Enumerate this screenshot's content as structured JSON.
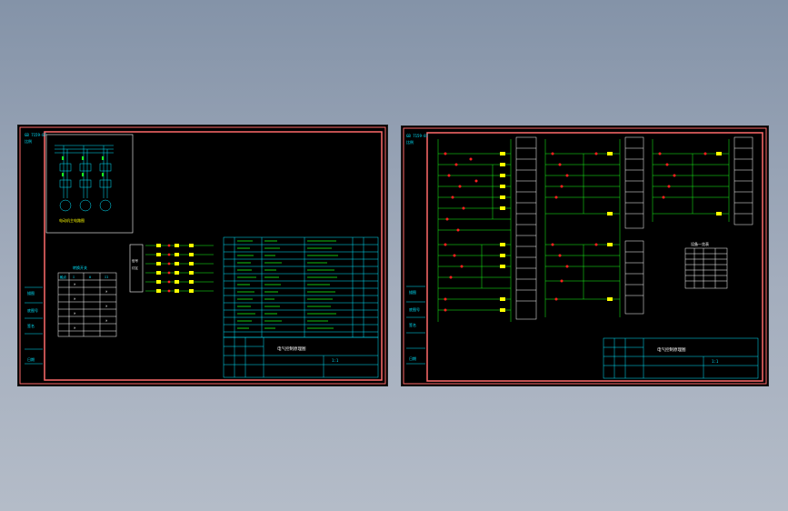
{
  "left_sheet": {
    "scale_note": "GB 7159-87",
    "scale_sub": "比例",
    "motor_caption": "电动机主电路图",
    "switch_table_title": "转换开关",
    "switch_table_headers": [
      "触点",
      "I",
      "0",
      "II"
    ],
    "panel_lines": [
      "信号",
      "灯区"
    ],
    "side_labels": [
      "描图",
      "底图号",
      "签名",
      "日期"
    ],
    "title_main": "电气控制原理图",
    "title_sub": "1:1"
  },
  "right_sheet": {
    "scale_note": "GB 7159-87",
    "scale_sub": "比例",
    "table_title": "设备一览表",
    "side_labels": [
      "描图",
      "底图号",
      "签名",
      "日期"
    ],
    "title_main": "电气控制原理图",
    "title_sub": "1:1"
  },
  "colors": {
    "border": "#ff6b6b",
    "cyan": "#00e5ff",
    "green": "#19ff19",
    "yellow": "#ffff00",
    "red": "#ff2020",
    "white": "#ffffff"
  }
}
